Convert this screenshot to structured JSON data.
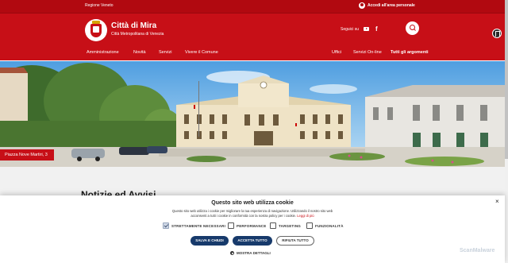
{
  "topbar": {
    "region_link": "Regione Veneto",
    "login_label": "Accedi all'area personale"
  },
  "header": {
    "site_title": "Città di Mira",
    "site_subtitle": "Città Metropolitana di Venezia",
    "follow_label": "Seguici su",
    "social": [
      "youtube-icon",
      "facebook-icon"
    ],
    "facebook_glyph": "f"
  },
  "nav": {
    "main": [
      "Amministrazione",
      "Novità",
      "Servizi",
      "Vivere il Comune"
    ],
    "secondary": [
      "Uffici",
      "Servizi On-line",
      "Tutti gli argomenti"
    ]
  },
  "hero": {
    "caption": "Piazza Nove Martiri, 3"
  },
  "content": {
    "news_title": "Notizie ed Avvisi"
  },
  "cookie_banner": {
    "close_glyph": "×",
    "title": "Questo sito web utilizza cookie",
    "text": "Questo sito web utilizza i cookie per migliorare la tua esperienza di navigazione. Utilizzando il nostro sito web acconsenti a tutti i cookie in conformità con la nostra policy per i cookie.",
    "link": "Leggi di più",
    "categories": [
      {
        "label": "STRETTAMENTE NECESSARI",
        "checked": true
      },
      {
        "label": "PERFORMANCE",
        "checked": false
      },
      {
        "label": "TARGETING",
        "checked": false
      },
      {
        "label": "FUNZIONALITÀ",
        "checked": false
      }
    ],
    "buttons": {
      "save": "SALVA E CHIUDI",
      "accept": "ACCETTA TUTTO",
      "reject": "RIFIUTA TUTTO"
    },
    "details": "MOSTRA DETTAGLI"
  },
  "watermark": "ScanMalware",
  "colors": {
    "brand_red": "#c70f17",
    "dark_red": "#b10910",
    "button_navy": "#173a6b"
  }
}
